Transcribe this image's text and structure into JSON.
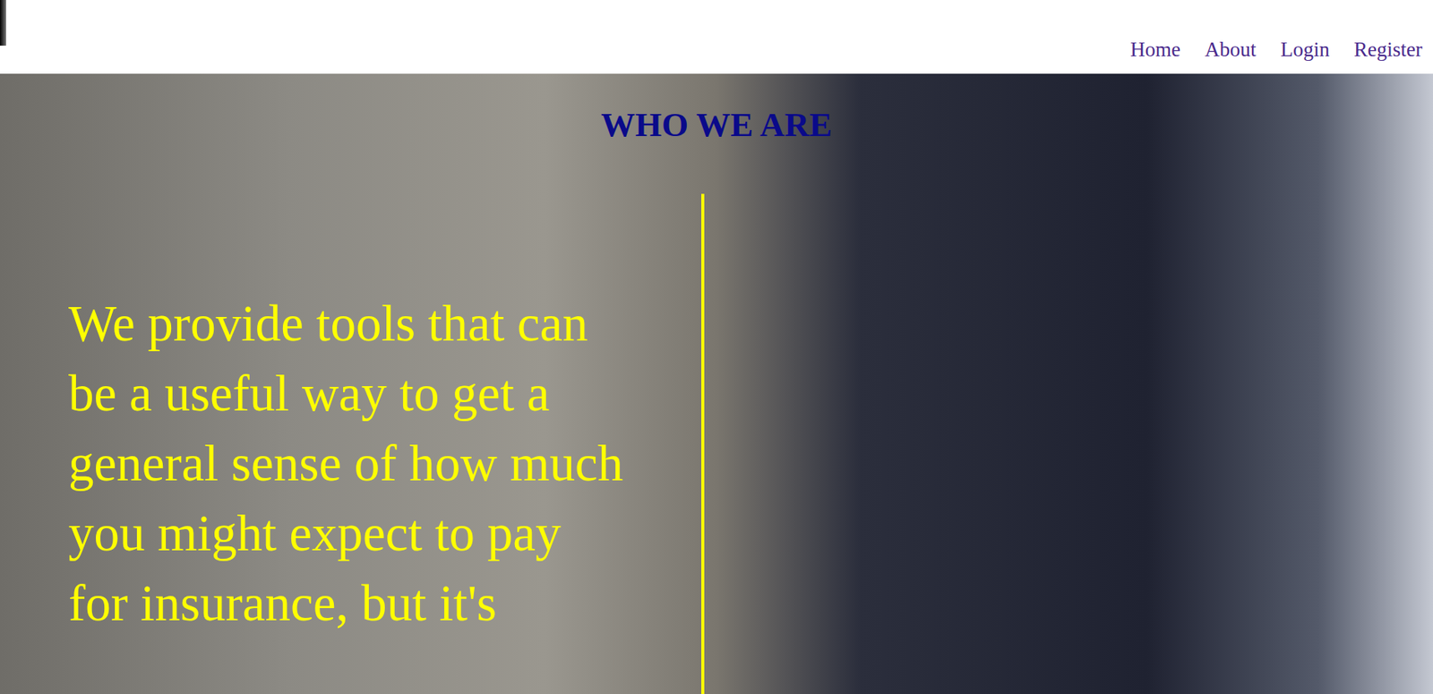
{
  "header": {
    "nav": [
      {
        "label": "Home"
      },
      {
        "label": "About"
      },
      {
        "label": "Login"
      },
      {
        "label": "Register"
      }
    ]
  },
  "hero": {
    "title": "WHO WE ARE",
    "text": "We provide tools that can be a useful way to get a general sense of how much you might expect to pay for insurance, but it's"
  }
}
